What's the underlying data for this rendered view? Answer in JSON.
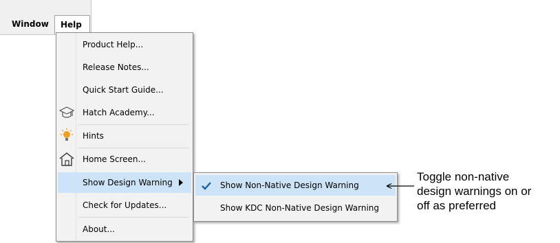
{
  "menubar": {
    "window_label": "Window",
    "help_label": "Help"
  },
  "help_menu": {
    "items": [
      {
        "label": "Product Help...",
        "icon": null
      },
      {
        "label": "Release Notes...",
        "icon": null
      },
      {
        "label": "Quick Start Guide...",
        "icon": null
      },
      {
        "label": "Hatch Academy...",
        "icon": "graduation-cap-icon"
      },
      {
        "label": "Hints",
        "icon": "lightbulb-icon"
      },
      {
        "label": "Home Screen...",
        "icon": "home-icon"
      },
      {
        "label": "Show Design Warning",
        "icon": null,
        "has_submenu": true,
        "highlighted": true
      },
      {
        "label": "Check for Updates...",
        "icon": null
      },
      {
        "label": "About...",
        "icon": null
      }
    ]
  },
  "submenu": {
    "items": [
      {
        "label": "Show Non-Native Design Warning",
        "checked": true,
        "highlighted": true
      },
      {
        "label": "Show KDC Non-Native Design Warning",
        "checked": false
      }
    ]
  },
  "annotation": {
    "lines": [
      "Toggle non-native",
      "design warnings on or",
      "off as preferred"
    ]
  },
  "colors": {
    "highlight": "#cde3f7",
    "menu_bg": "#f2f2f2",
    "check": "#1a5fa8",
    "bulb": "#f0a020"
  }
}
